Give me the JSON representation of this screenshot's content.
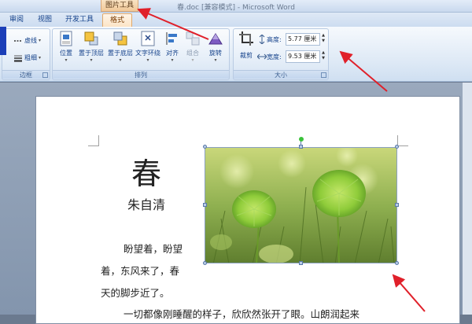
{
  "window": {
    "title": "春.doc [兼容模式] - Microsoft Word",
    "context_tab_label": "图片工具"
  },
  "tabs": [
    {
      "label": "审阅",
      "active": false
    },
    {
      "label": "视图",
      "active": false
    },
    {
      "label": "开发工具",
      "active": false
    },
    {
      "label": "格式",
      "active": true
    }
  ],
  "ribbon": {
    "border_group": {
      "label": "边框",
      "dashes_label": "虚线",
      "weight_label": "粗细"
    },
    "arrange_group": {
      "label": "排列",
      "buttons": [
        {
          "label": "位置",
          "icon": "position-icon",
          "enabled": true
        },
        {
          "label": "置于顶层",
          "icon": "bring-to-front-icon",
          "enabled": true
        },
        {
          "label": "置于底层",
          "icon": "send-to-back-icon",
          "enabled": true
        },
        {
          "label": "文字环绕",
          "icon": "text-wrap-icon",
          "enabled": true
        },
        {
          "label": "对齐",
          "icon": "align-icon",
          "enabled": true
        },
        {
          "label": "组合",
          "icon": "group-icon",
          "enabled": false
        },
        {
          "label": "旋转",
          "icon": "rotate-icon",
          "enabled": true
        }
      ]
    },
    "size_group": {
      "label": "大小",
      "crop_label": "裁剪",
      "height_label": "高度:",
      "height_value": "5.77 厘米",
      "width_label": "宽度:",
      "width_value": "9.53 厘米"
    }
  },
  "document": {
    "title": "春",
    "author": "朱自清",
    "lines": [
      "盼望着，盼望",
      "着，东风来了，春",
      "天的脚步近了。",
      "一切都像刚睡醒的样子，欣欣然张开了眼。山朗润起来"
    ]
  },
  "colors": {
    "active_tab": "#fce4c6",
    "arrow": "#e0202a",
    "ribbon_text": "#15428b"
  }
}
